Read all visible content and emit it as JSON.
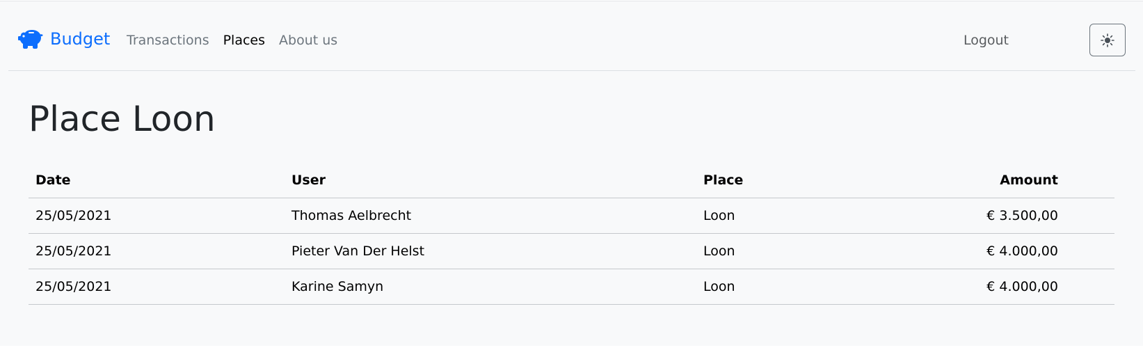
{
  "brand": {
    "name": "Budget",
    "icon": "piggy-bank-icon",
    "color": "#0d6efd"
  },
  "nav": {
    "items": [
      {
        "label": "Transactions",
        "active": false
      },
      {
        "label": "Places",
        "active": true
      },
      {
        "label": "About us",
        "active": false
      }
    ],
    "logout_label": "Logout",
    "theme_toggle_icon": "sun-icon"
  },
  "page": {
    "title": "Place Loon"
  },
  "table": {
    "headers": {
      "date": "Date",
      "user": "User",
      "place": "Place",
      "amount": "Amount"
    },
    "rows": [
      {
        "date": "25/05/2021",
        "user": "Thomas Aelbrecht",
        "place": "Loon",
        "amount": "€ 3.500,00"
      },
      {
        "date": "25/05/2021",
        "user": "Pieter Van Der Helst",
        "place": "Loon",
        "amount": "€ 4.000,00"
      },
      {
        "date": "25/05/2021",
        "user": "Karine Samyn",
        "place": "Loon",
        "amount": "€ 4.000,00"
      }
    ]
  }
}
